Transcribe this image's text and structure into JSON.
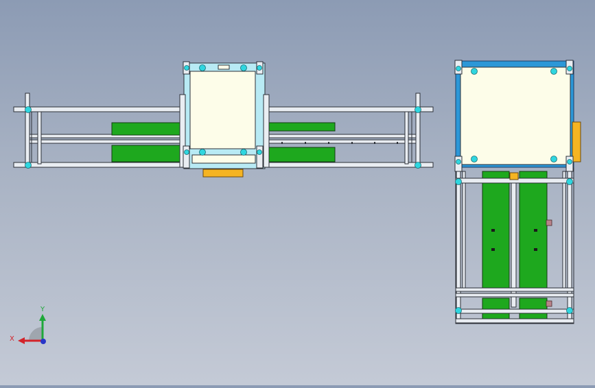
{
  "viewport": {
    "background_top": "#8c9bb4",
    "background_bottom": "#c4cad6"
  },
  "colors": {
    "frame_outline": "#2b2f36",
    "frame_fill": "#e9edf2",
    "plate_fill": "#fdfde9",
    "carriage_light": "#b8eaf4",
    "carriage_blue": "#2c97d7",
    "green_panel": "#1ea81e",
    "orange_block": "#f5b422",
    "cyan_node": "#2fd6df",
    "axis_x": "#d3232a",
    "axis_y": "#1fa83a",
    "axis_z": "#2836c8"
  },
  "triad": {
    "x_label": "X",
    "y_label": "Y",
    "icon": "coordinate-triad-icon"
  }
}
